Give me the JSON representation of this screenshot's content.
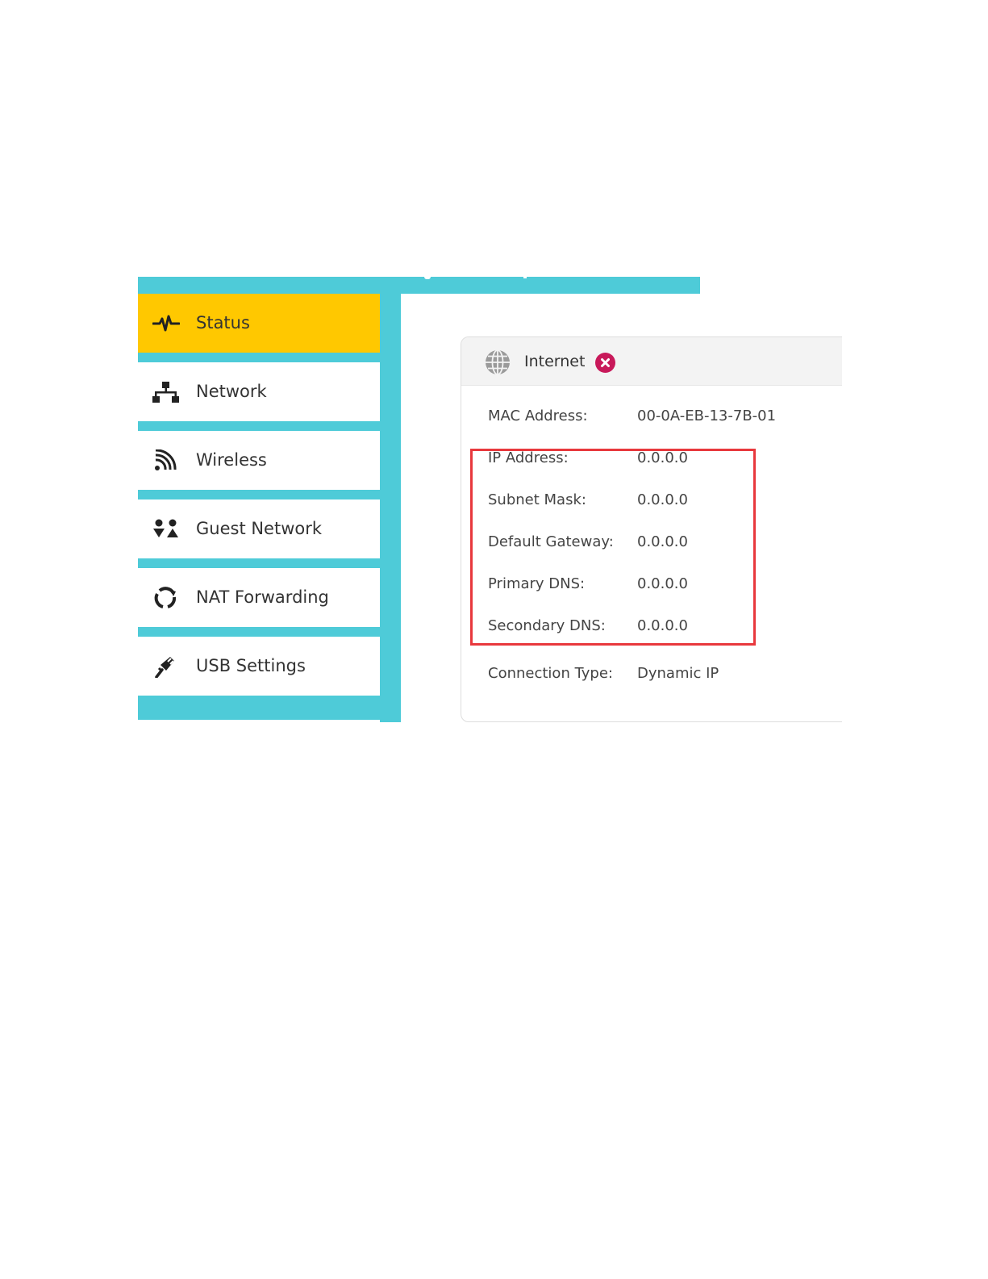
{
  "nav": {
    "items": [
      {
        "label": "Status",
        "icon": "pulse-icon",
        "active": true
      },
      {
        "label": "Network",
        "icon": "network-icon",
        "active": false
      },
      {
        "label": "Wireless",
        "icon": "wireless-icon",
        "active": false
      },
      {
        "label": "Guest Network",
        "icon": "guest-network-icon",
        "active": false
      },
      {
        "label": "NAT Forwarding",
        "icon": "nat-forwarding-icon",
        "active": false
      },
      {
        "label": "USB Settings",
        "icon": "usb-icon",
        "active": false
      }
    ]
  },
  "card": {
    "title": "Internet",
    "status_icon": "error-x-icon",
    "rows": [
      {
        "label": "MAC Address:",
        "value": "00-0A-EB-13-7B-01"
      },
      {
        "label": "IP Address:",
        "value": "0.0.0.0"
      },
      {
        "label": "Subnet Mask:",
        "value": "0.0.0.0"
      },
      {
        "label": "Default Gateway:",
        "value": "0.0.0.0"
      },
      {
        "label": "Primary DNS:",
        "value": "0.0.0.0"
      },
      {
        "label": "Secondary DNS:",
        "value": "0.0.0.0"
      },
      {
        "label": "Connection Type:",
        "value": "Dynamic IP"
      }
    ]
  },
  "colors": {
    "sidebar_accent": "#4ecbd8",
    "active_item": "#ffc800",
    "error_badge": "#c8195a",
    "highlight_box": "#e8383d"
  }
}
